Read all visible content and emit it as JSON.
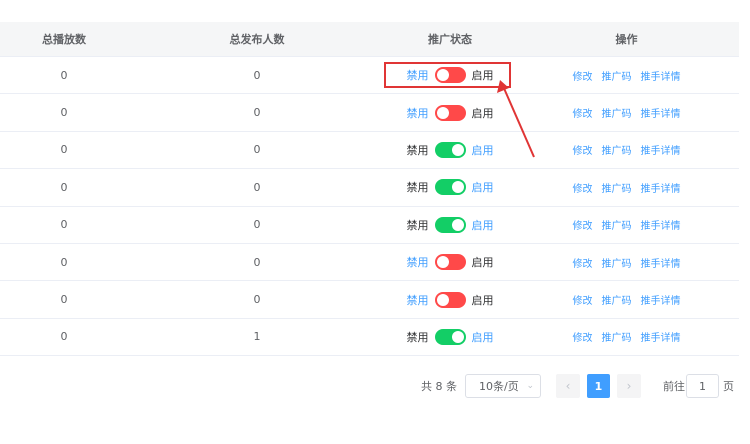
{
  "table": {
    "headers": [
      "总播放数",
      "总发布人数",
      "推广状态",
      "操作"
    ],
    "rows": [
      {
        "plays": "0",
        "publishers": "0",
        "status": "off"
      },
      {
        "plays": "0",
        "publishers": "0",
        "status": "off"
      },
      {
        "plays": "0",
        "publishers": "0",
        "status": "on"
      },
      {
        "plays": "0",
        "publishers": "0",
        "status": "on"
      },
      {
        "plays": "0",
        "publishers": "0",
        "status": "on"
      },
      {
        "plays": "0",
        "publishers": "0",
        "status": "off"
      },
      {
        "plays": "0",
        "publishers": "0",
        "status": "off"
      },
      {
        "plays": "0",
        "publishers": "1",
        "status": "on"
      }
    ],
    "switch_labels": {
      "disable": "禁用",
      "enable": "启用"
    },
    "actions": [
      "修改",
      "推广码",
      "推手详情"
    ]
  },
  "colors": {
    "switch_on": "#13ce66",
    "switch_off": "#ff4949",
    "link": "#409eff",
    "highlight": "#e03535"
  },
  "pagination": {
    "total": "共 8 条",
    "page_size": "10条/页",
    "current_page": "1",
    "goto_label": "前往",
    "goto_value": "1",
    "goto_suffix": "页",
    "prev_icon": "chevron-left-icon",
    "next_icon": "chevron-right-icon"
  }
}
